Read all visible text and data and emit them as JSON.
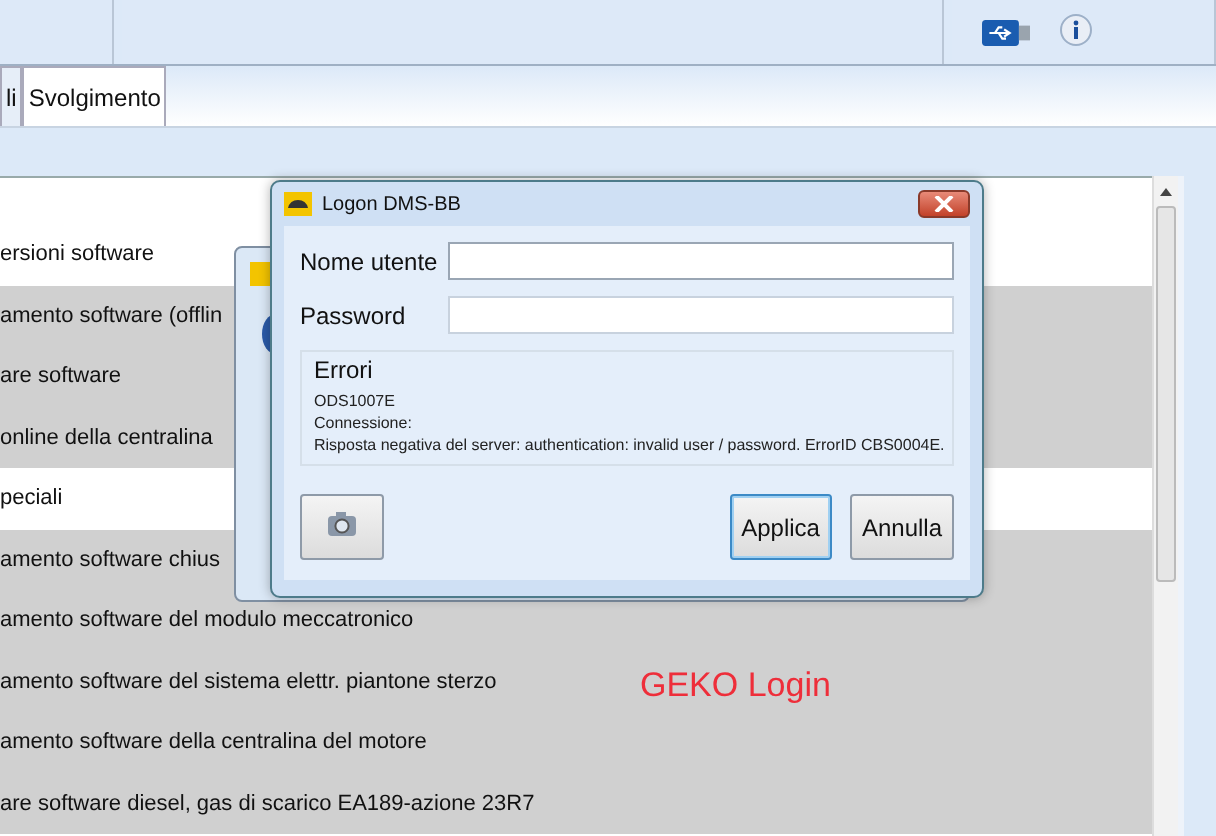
{
  "tabs": [
    {
      "label": "li",
      "selected": false
    },
    {
      "label": "Svolgimento",
      "selected": true
    }
  ],
  "list": [
    {
      "label": "ersioni software",
      "kind": "group"
    },
    {
      "label": "amento software (offlin",
      "kind": "item"
    },
    {
      "label": "are software",
      "kind": "item"
    },
    {
      "label": " online della centralina",
      "kind": "item"
    },
    {
      "label": "peciali",
      "kind": "group"
    },
    {
      "label": "amento software chius",
      "kind": "item"
    },
    {
      "label": "amento software del modulo meccatronico",
      "kind": "item"
    },
    {
      "label": "amento software del sistema elettr. piantone sterzo",
      "kind": "item"
    },
    {
      "label": "amento software della centralina del motore",
      "kind": "item"
    },
    {
      "label": "are software diesel, gas di scarico EA189-azione 23R7",
      "kind": "item"
    }
  ],
  "annotation": "GEKO Login",
  "dialog": {
    "title": "Logon DMS-BB",
    "fields": [
      {
        "label": "Nome utente",
        "focused": true
      },
      {
        "label": "Password",
        "focused": false
      }
    ],
    "errors": {
      "title": "Errori",
      "lines": [
        "ODS1007E",
        "Connessione:",
        "Risposta negativa del server: authentication: invalid user / password. ErrorID CBS0004E."
      ]
    },
    "buttons": [
      {
        "label": "Applica",
        "default": true
      },
      {
        "label": "Annulla",
        "default": false
      }
    ]
  }
}
